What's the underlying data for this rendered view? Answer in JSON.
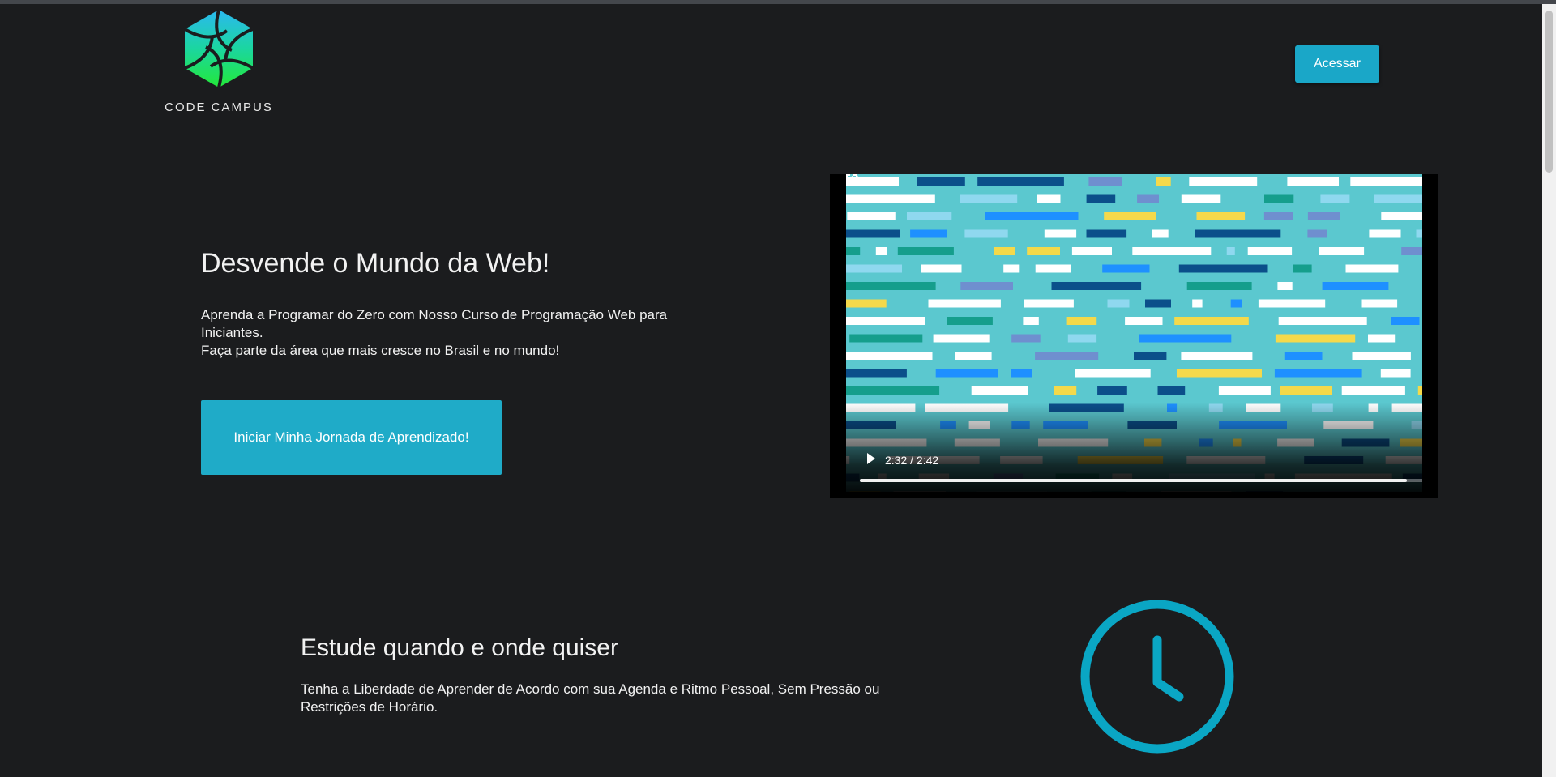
{
  "brand": {
    "name": "CODE CAMPUS",
    "logo_icon": "camera-aperture-icon"
  },
  "header": {
    "access_button": "Acessar"
  },
  "hero": {
    "title": "Desvende o Mundo da Web!",
    "line1": "Aprenda a Programar do Zero com Nosso Curso de Programação Web para Iniciantes.",
    "line2": "Faça parte da área que mais cresce no Brasil e no mundo!",
    "cta": "Iniciar Minha Jornada de Aprendizado!"
  },
  "video": {
    "time": "2:32 / 2:42",
    "progress": 0.94
  },
  "features": [
    {
      "title": "Estude quando e onde quiser",
      "text": "Tenha a Liberdade de Aprender de Acordo com sua Agenda e Ritmo Pessoal, Sem Pressão ou Restrições de Horário.",
      "icon": "clock-icon"
    }
  ],
  "colors": {
    "background": "#1b1c1e",
    "accent": "#1fabc8",
    "video_bg": "#5bc8cf"
  }
}
